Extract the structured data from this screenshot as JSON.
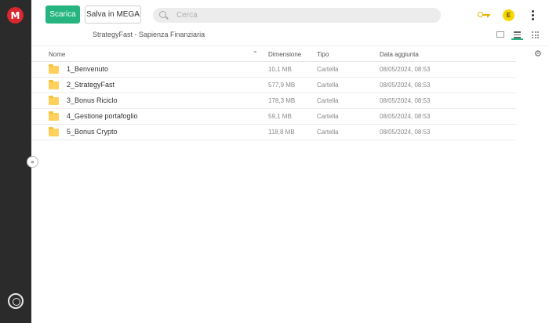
{
  "toolbar": {
    "download_label": "Scarica",
    "save_label": "Salva in MEGA"
  },
  "search": {
    "placeholder": "Cerca"
  },
  "account": {
    "avatar_initial": "E"
  },
  "breadcrumb": "StrategyFast - Sapienza Finanziaria",
  "table": {
    "columns": {
      "name": "Nome",
      "size": "Dimensione",
      "type": "Tipo",
      "date": "Data aggiunta"
    },
    "rows": [
      {
        "name": "1_Benvenuto",
        "size": "10,1 MB",
        "type": "Cartella",
        "date": "08/05/2024, 08:53"
      },
      {
        "name": "2_StrategyFast",
        "size": "577,9 MB",
        "type": "Cartella",
        "date": "08/05/2024, 08:53"
      },
      {
        "name": "3_Bonus Riciclo",
        "size": "178,3 MB",
        "type": "Cartella",
        "date": "08/05/2024, 08:53"
      },
      {
        "name": "4_Gestione portafoglio",
        "size": "59,1 MB",
        "type": "Cartella",
        "date": "08/05/2024, 08:53"
      },
      {
        "name": "5_Bonus Crypto",
        "size": "118,8 MB",
        "type": "Cartella",
        "date": "08/05/2024, 08:53"
      }
    ]
  },
  "logo": {
    "letter": "M"
  },
  "icons": {
    "logo": "mega-logo-icon",
    "search": "search-icon",
    "key": "key-icon",
    "menu": "kebab-menu-icon",
    "view_thumbnail": "thumbnail-view-icon",
    "view_list": "list-view-icon",
    "view_grid": "grid-view-icon",
    "settings": "gear-icon",
    "folder": "folder-icon",
    "sort": "chevron-up-icon",
    "collapse": "expand-sidebar-icon",
    "sidebar_bottom": "rubbish-bin-icon"
  },
  "colors": {
    "accent": "#26b580",
    "brand": "#d9272e",
    "sidebar": "#2b2b2b",
    "folder": "#ffd15c",
    "key": "#e6b400",
    "avatar": "#f7d600"
  }
}
